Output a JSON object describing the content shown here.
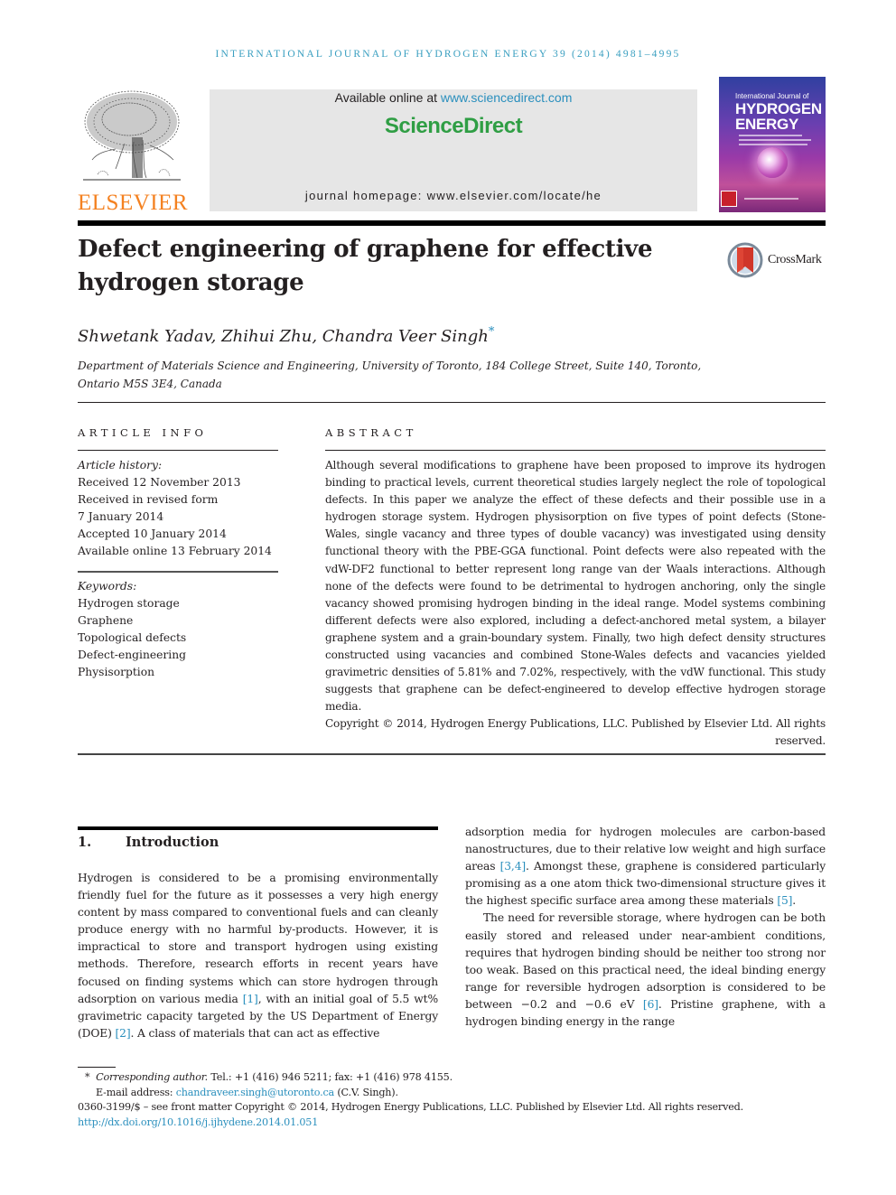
{
  "running_head": "INTERNATIONAL JOURNAL OF HYDROGEN ENERGY 39 (2014) 4981–4995",
  "masthead": {
    "publisher_logo_text": "ELSEVIER",
    "available_prefix": "Available online at ",
    "available_link": "www.sciencedirect.com",
    "brand": "ScienceDirect",
    "homepage": "journal homepage: www.elsevier.com/locate/he",
    "cover": {
      "small_title": "International Journal of",
      "big_title_line1": "HYDROGEN",
      "big_title_line2": "ENERGY"
    }
  },
  "article": {
    "title": "Defect engineering of graphene for effective hydrogen storage",
    "crossmark_label": "CrossMark",
    "authors": "Shwetank Yadav, Zhihui Zhu, Chandra Veer Singh",
    "corresponding_mark": "*",
    "affiliation_line1": "Department of Materials Science and Engineering, University of Toronto, 184 College Street, Suite 140, Toronto,",
    "affiliation_line2": "Ontario M5S 3E4, Canada"
  },
  "article_info": {
    "heading": "ARTICLE INFO",
    "history_label": "Article history:",
    "history": [
      "Received 12 November 2013",
      "Received in revised form",
      "7 January 2014",
      "Accepted 10 January 2014",
      "Available online 13 February 2014"
    ],
    "keywords_label": "Keywords:",
    "keywords": [
      "Hydrogen storage",
      "Graphene",
      "Topological defects",
      "Defect-engineering",
      "Physisorption"
    ]
  },
  "abstract": {
    "heading": "ABSTRACT",
    "text": "Although several modifications to graphene have been proposed to improve its hydrogen binding to practical levels, current theoretical studies largely neglect the role of topological defects. In this paper we analyze the effect of these defects and their possible use in a hydrogen storage system. Hydrogen physisorption on five types of point defects (Stone-Wales, single vacancy and three types of double vacancy) was investigated using density functional theory with the PBE-GGA functional. Point defects were also repeated with the vdW-DF2 functional to better represent long range van der Waals interactions. Although none of the defects were found to be detrimental to hydrogen anchoring, only the single vacancy showed promising hydrogen binding in the ideal range. Model systems combining different defects were also explored, including a defect-anchored metal system, a bilayer graphene system and a grain-boundary system. Finally, two high defect density structures constructed using vacancies and combined Stone-Wales defects and vacancies yielded gravimetric densities of 5.81% and 7.02%, respectively, with the vdW functional. This study suggests that graphene can be defect-engineered to develop effective hydrogen storage media.",
    "copyright": "Copyright © 2014, Hydrogen Energy Publications, LLC. Published by Elsevier Ltd. All rights reserved."
  },
  "introduction": {
    "number": "1.",
    "title": "Introduction",
    "left_col": {
      "p1_a": "Hydrogen is considered to be a promising environmentally friendly fuel for the future as it possesses a very high energy content by mass compared to conventional fuels and can cleanly produce energy with no harmful by-products. However, it is impractical to store and transport hydrogen using existing methods. Therefore, research efforts in recent years have focused on finding systems which can store hydrogen through adsorption on various media ",
      "ref1": "[1]",
      "p1_b": ", with an initial goal of 5.5 wt% gravimetric capacity targeted by the US Department of Energy (DOE) ",
      "ref2": "[2]",
      "p1_c": ". A class of materials that can act as effective"
    },
    "right_col": {
      "p1_a": "adsorption media for hydrogen molecules are carbon-based nanostructures, due to their relative low weight and high surface areas ",
      "ref34": "[3,4]",
      "p1_b": ". Amongst these, graphene is considered particularly promising as a one atom thick two-dimensional structure gives it the highest specific surface area among these materials ",
      "ref5": "[5]",
      "p1_c": ".",
      "p2_a": "The need for reversible storage, where hydrogen can be both easily stored and released under near-ambient conditions, requires that hydrogen binding should be neither too strong nor too weak. Based on this practical need, the ideal binding energy range for reversible hydrogen adsorption is considered to be between −0.2 and −0.6 eV ",
      "ref6": "[6]",
      "p2_b": ". Pristine graphene, with a hydrogen binding energy in the range"
    }
  },
  "footnotes": {
    "star": "*",
    "corresponding_label": "Corresponding author.",
    "contact": " Tel.: +1 (416) 946 5211; fax: +1 (416) 978 4155.",
    "email_label": "E-mail address: ",
    "email": "chandraveer.singh@utoronto.ca",
    "email_suffix": " (C.V. Singh).",
    "issn_line": "0360-3199/$ – see front matter Copyright © 2014, Hydrogen Energy Publications, LLC. Published by Elsevier Ltd. All rights reserved.",
    "doi": "http://dx.doi.org/10.1016/j.ijhydene.2014.01.051"
  },
  "colors": {
    "link": "#2a8fbd",
    "running_head": "#3a9fc0",
    "elsevier_orange": "#f48120",
    "sciencedirect_green": "#2f9e44",
    "masthead_gray": "#e6e6e6"
  }
}
